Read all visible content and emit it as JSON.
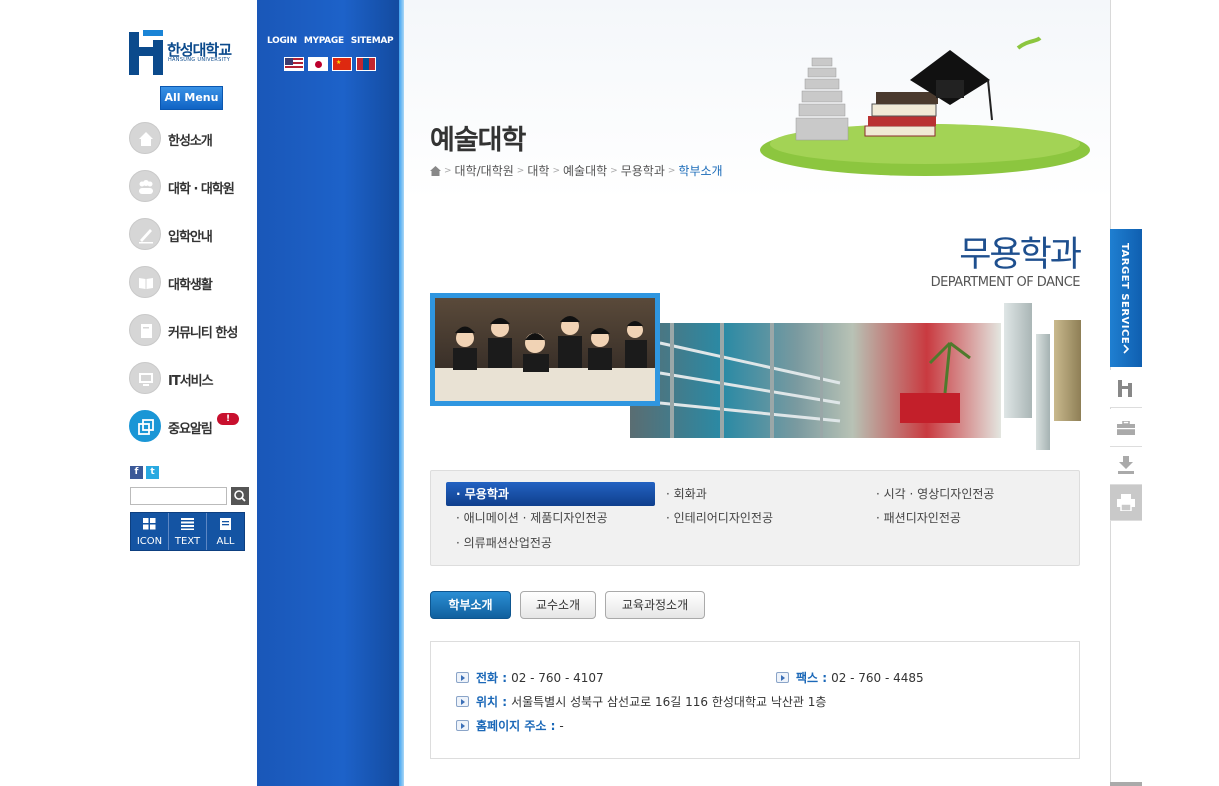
{
  "logo": {
    "name": "한성대학교",
    "sub": "HANSUNG UNIVERSITY"
  },
  "all_menu_label": "All Menu",
  "nav": [
    {
      "label": "한성소개",
      "icon": "home-icon"
    },
    {
      "label": "대학 · 대학원",
      "icon": "people-icon"
    },
    {
      "label": "입학안내",
      "icon": "pen-icon"
    },
    {
      "label": "대학생활",
      "icon": "book-icon"
    },
    {
      "label": "커뮤니티 한성",
      "icon": "board-icon"
    },
    {
      "label": "IT서비스",
      "icon": "monitor-icon"
    },
    {
      "label": "중요알림",
      "icon": "notice-icon",
      "badge": "!"
    }
  ],
  "view_tabs": [
    "ICON",
    "TEXT",
    "ALL"
  ],
  "top_links": [
    "LOGIN",
    "MYPAGE",
    "SITEMAP"
  ],
  "flags": [
    "us-flag",
    "japan-flag",
    "china-flag",
    "mongolia-flag"
  ],
  "section_title": "예술대학",
  "breadcrumb": [
    "대학/대학원",
    "대학",
    "예술대학",
    "무용학과",
    "학부소개"
  ],
  "dept": {
    "title": "무용학과",
    "subtitle": "DEPARTMENT OF DANCE"
  },
  "subtabs": [
    "· 무용학과",
    "· 회화과",
    "· 시각 · 영상디자인전공",
    "· 애니메이션 · 제품디자인전공",
    "· 인테리어디자인전공",
    "· 패션디자인전공",
    "· 의류패션산업전공"
  ],
  "content_tabs": [
    "학부소개",
    "교수소개",
    "교육과정소개"
  ],
  "info": {
    "phone_label": "전화 :",
    "phone": "02 - 760 - 4107",
    "fax_label": "팩스 :",
    "fax": "02 - 760 - 4485",
    "location_label": "위치 :",
    "location": "서울특별시 성북구 삼선교로 16길 116 한성대학교 낙산관 1층",
    "homepage_label": "홈페이지 주소 :",
    "homepage": "-"
  },
  "target_service": "TARGET SERVICE",
  "colors": {
    "accent": "#1d62c9",
    "dept_title": "#1e4f8e",
    "active_tab": "#11609e"
  }
}
